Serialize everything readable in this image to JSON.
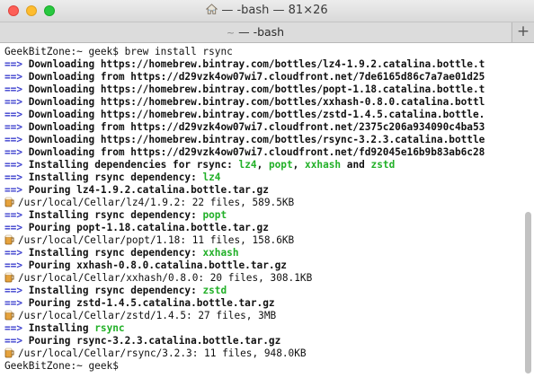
{
  "window": {
    "title": "— -bash — 81×26",
    "tab_title": "— -bash",
    "tab_prefix": "~",
    "new_tab_label": "+"
  },
  "terminal": {
    "prompt": "GeekBitZone:~ geek$",
    "command": "brew install rsync",
    "arrow": "==>",
    "lines": [
      {
        "type": "arrow",
        "text": "Downloading https://homebrew.bintray.com/bottles/lz4-1.9.2.catalina.bottle.t"
      },
      {
        "type": "arrow",
        "text": "Downloading from https://d29vzk4ow07wi7.cloudfront.net/7de6165d86c7a7ae01d25"
      },
      {
        "type": "arrow",
        "text": "Downloading https://homebrew.bintray.com/bottles/popt-1.18.catalina.bottle.t"
      },
      {
        "type": "arrow",
        "text": "Downloading https://homebrew.bintray.com/bottles/xxhash-0.8.0.catalina.bottl"
      },
      {
        "type": "arrow",
        "text": "Downloading https://homebrew.bintray.com/bottles/zstd-1.4.5.catalina.bottle."
      },
      {
        "type": "arrow",
        "text": "Downloading from https://d29vzk4ow07wi7.cloudfront.net/2375c206a934090c4ba53"
      },
      {
        "type": "arrow",
        "text": "Downloading https://homebrew.bintray.com/bottles/rsync-3.2.3.catalina.bottle"
      },
      {
        "type": "arrow",
        "text": "Downloading from https://d29vzk4ow07wi7.cloudfront.net/fd92045e16b9b83ab6c28"
      },
      {
        "type": "deps",
        "text": "Installing dependencies for rsync:",
        "d1": "lz4",
        "d2": "popt",
        "d3": "xxhash",
        "and": "and",
        "d4": "zstd"
      },
      {
        "type": "dep",
        "text": "Installing rsync dependency:",
        "name": "lz4"
      },
      {
        "type": "arrow",
        "text": "Pouring lz4-1.9.2.catalina.bottle.tar.gz"
      },
      {
        "type": "beer",
        "text": "/usr/local/Cellar/lz4/1.9.2: 22 files, 589.5KB"
      },
      {
        "type": "dep",
        "text": "Installing rsync dependency:",
        "name": "popt"
      },
      {
        "type": "arrow",
        "text": "Pouring popt-1.18.catalina.bottle.tar.gz"
      },
      {
        "type": "beer",
        "text": "/usr/local/Cellar/popt/1.18: 11 files, 158.6KB"
      },
      {
        "type": "dep",
        "text": "Installing rsync dependency:",
        "name": "xxhash"
      },
      {
        "type": "arrow",
        "text": "Pouring xxhash-0.8.0.catalina.bottle.tar.gz"
      },
      {
        "type": "beer",
        "text": "/usr/local/Cellar/xxhash/0.8.0: 20 files, 308.1KB"
      },
      {
        "type": "dep",
        "text": "Installing rsync dependency:",
        "name": "zstd"
      },
      {
        "type": "arrow",
        "text": "Pouring zstd-1.4.5.catalina.bottle.tar.gz"
      },
      {
        "type": "beer",
        "text": "/usr/local/Cellar/zstd/1.4.5: 27 files, 3MB"
      },
      {
        "type": "dep",
        "text": "Installing",
        "name": "rsync"
      },
      {
        "type": "arrow",
        "text": "Pouring rsync-3.2.3.catalina.bottle.tar.gz"
      },
      {
        "type": "beer",
        "text": "/usr/local/Cellar/rsync/3.2.3: 11 files, 948.0KB"
      }
    ]
  },
  "colors": {
    "arrow": "#3b3fce",
    "highlight": "#22b028"
  },
  "icons": {
    "title": "home-icon",
    "pour": "beer-icon"
  }
}
